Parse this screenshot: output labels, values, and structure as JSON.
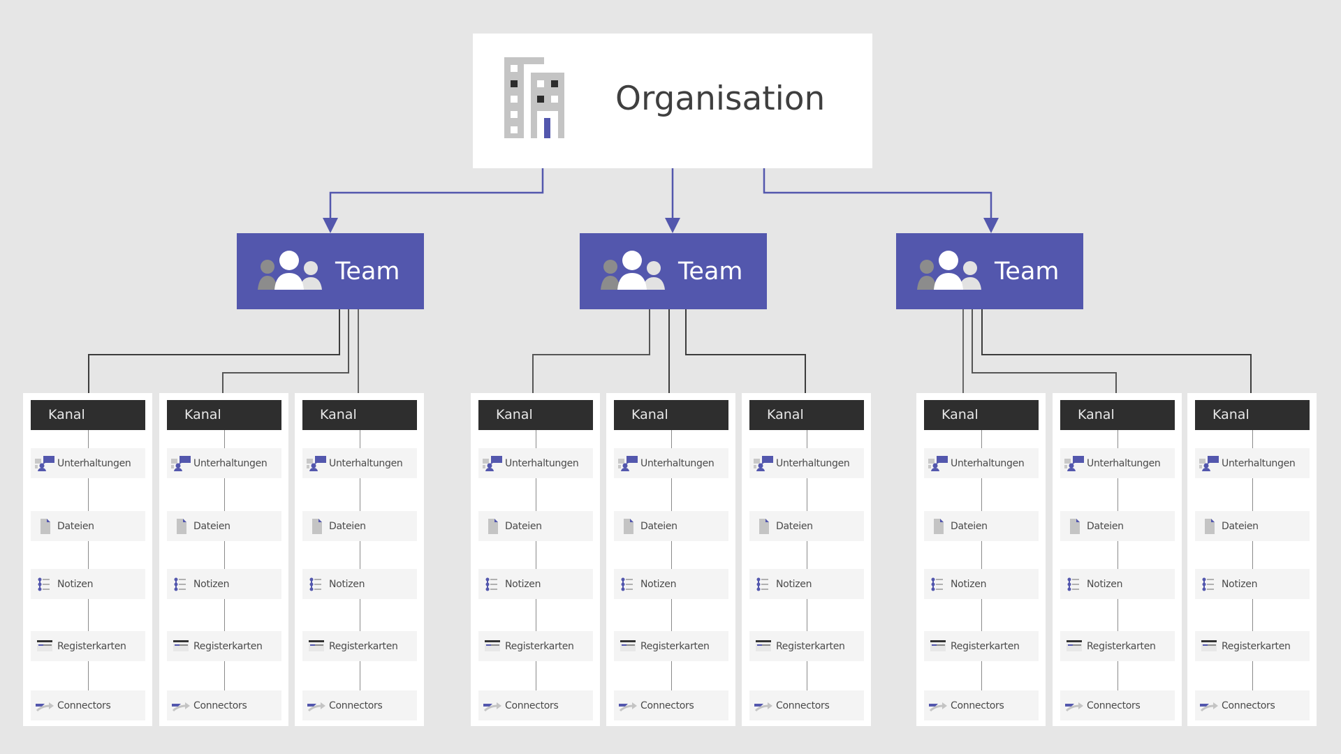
{
  "colors": {
    "background": "#e6e6e6",
    "accent": "#5357ad",
    "channel_header": "#2e2e2e",
    "connector_dark": "#4a4a4a",
    "item_background": "#f4f4f4"
  },
  "organisation": {
    "label": "Organisation",
    "icon": "building-icon"
  },
  "teams": [
    {
      "label": "Team",
      "icon": "people-icon",
      "channels": [
        {
          "label": "Kanal",
          "items": [
            "Unterhaltungen",
            "Dateien",
            "Notizen",
            "Registerkarten",
            "Connectors"
          ]
        },
        {
          "label": "Kanal",
          "items": [
            "Unterhaltungen",
            "Dateien",
            "Notizen",
            "Registerkarten",
            "Connectors"
          ]
        },
        {
          "label": "Kanal",
          "items": [
            "Unterhaltungen",
            "Dateien",
            "Notizen",
            "Registerkarten",
            "Connectors"
          ]
        }
      ]
    },
    {
      "label": "Team",
      "icon": "people-icon",
      "channels": [
        {
          "label": "Kanal",
          "items": [
            "Unterhaltungen",
            "Dateien",
            "Notizen",
            "Registerkarten",
            "Connectors"
          ]
        },
        {
          "label": "Kanal",
          "items": [
            "Unterhaltungen",
            "Dateien",
            "Notizen",
            "Registerkarten",
            "Connectors"
          ]
        },
        {
          "label": "Kanal",
          "items": [
            "Unterhaltungen",
            "Dateien",
            "Notizen",
            "Registerkarten",
            "Connectors"
          ]
        }
      ]
    },
    {
      "label": "Team",
      "icon": "people-icon",
      "channels": [
        {
          "label": "Kanal",
          "items": [
            "Unterhaltungen",
            "Dateien",
            "Notizen",
            "Registerkarten",
            "Connectors"
          ]
        },
        {
          "label": "Kanal",
          "items": [
            "Unterhaltungen",
            "Dateien",
            "Notizen",
            "Registerkarten",
            "Connectors"
          ]
        },
        {
          "label": "Kanal",
          "items": [
            "Unterhaltungen",
            "Dateien",
            "Notizen",
            "Registerkarten",
            "Connectors"
          ]
        }
      ]
    }
  ],
  "item_icons": [
    "conversations-icon",
    "file-icon",
    "notes-list-icon",
    "tabs-icon",
    "connector-arrow-icon"
  ]
}
